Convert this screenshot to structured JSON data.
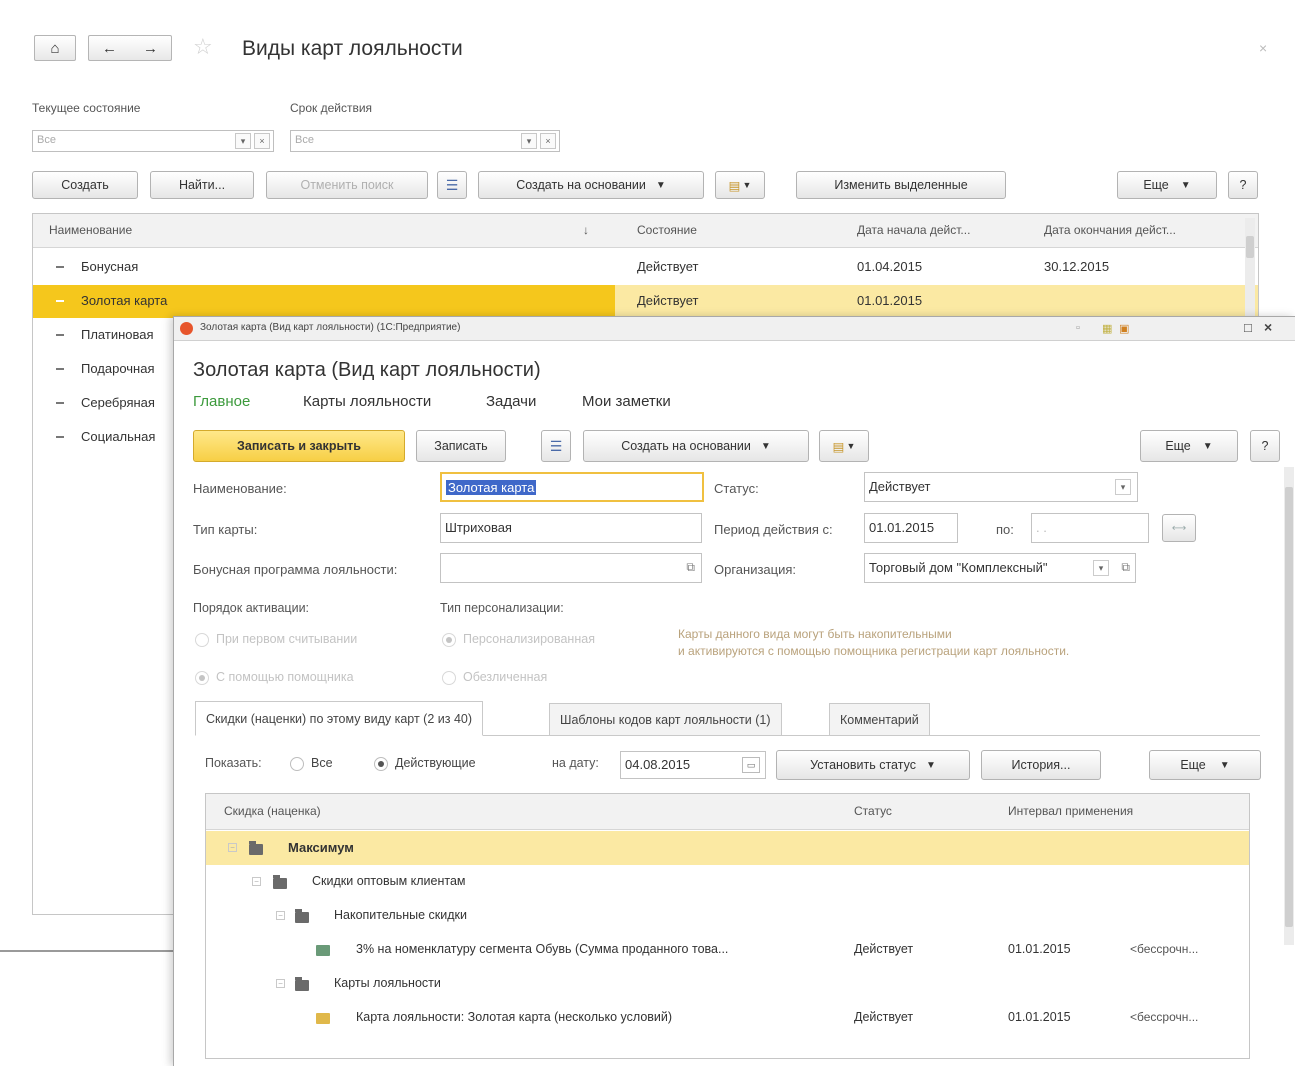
{
  "list_window": {
    "title": "Виды карт лояльности",
    "close": "×",
    "filters": {
      "state_label": "Текущее состояние",
      "state_value": "Все",
      "period_label": "Срок действия",
      "period_value": "Все"
    },
    "toolbar": {
      "create": "Создать",
      "find": "Найти...",
      "cancel_search": "Отменить поиск",
      "create_based_on": "Создать на основании",
      "change_selected": "Изменить выделенные",
      "more": "Еще",
      "help": "?"
    },
    "columns": [
      "Наименование",
      "Состояние",
      "Дата начала дейст...",
      "Дата окончания дейст..."
    ],
    "sort_indicator": "↓",
    "rows": [
      {
        "name": "Бонусная",
        "state": "Действует",
        "start": "01.04.2015",
        "end": "30.12.2015"
      },
      {
        "name": "Золотая карта",
        "state": "Действует",
        "start": "01.01.2015",
        "end": ""
      },
      {
        "name": "Платиновая",
        "state": "",
        "start": "",
        "end": ""
      },
      {
        "name": "Подарочная",
        "state": "",
        "start": "",
        "end": ""
      },
      {
        "name": "Серебряная",
        "state": "",
        "start": "",
        "end": ""
      },
      {
        "name": "Социальная",
        "state": "",
        "start": "",
        "end": ""
      }
    ]
  },
  "form_window": {
    "titlebar": "Золотая карта (Вид карт лояльности) (1С:Предприятие)",
    "title": "Золотая карта (Вид карт лояльности)",
    "nav": [
      "Главное",
      "Карты лояльности",
      "Задачи",
      "Мои заметки"
    ],
    "toolbar": {
      "save_close": "Записать и закрыть",
      "save": "Записать",
      "create_based_on": "Создать на основании",
      "more": "Еще",
      "help": "?"
    },
    "fields": {
      "name_label": "Наименование:",
      "name_value": "Золотая карта",
      "status_label": "Статус:",
      "status_value": "Действует",
      "card_type_label": "Тип карты:",
      "card_type_value": "Штриховая",
      "period_label": "Период действия с:",
      "period_from": "01.01.2015",
      "period_to_label": "по:",
      "period_to_placeholder": ". .",
      "bonus_label": "Бонусная программа лояльности:",
      "org_label": "Организация:",
      "org_value": "Торговый дом \"Комплексный\"",
      "activation_label": "Порядок активации:",
      "activation_options": [
        "При первом считывании",
        "С помощью помощника"
      ],
      "personalization_label": "Тип персонализации:",
      "personalization_options": [
        "Персонализированная",
        "Обезличенная"
      ],
      "hint_line1": "Карты данного вида могут быть накопительными",
      "hint_line2": "и активируются с помощью помощника регистрации карт лояльности."
    },
    "tabs": [
      "Скидки (наценки) по этому виду карт (2 из 40)",
      "Шаблоны кодов карт лояльности (1)",
      "Комментарий"
    ],
    "discounts_toolbar": {
      "show_label": "Показать:",
      "all": "Все",
      "active": "Действующие",
      "date_label": "на дату:",
      "date_value": "04.08.2015",
      "set_status": "Установить статус",
      "history": "История...",
      "more": "Еще"
    },
    "discount_columns": [
      "Скидка (наценка)",
      "Статус",
      "Интервал применения"
    ],
    "discount_rows": [
      {
        "name": "Максимум",
        "status": "",
        "from": "",
        "to": "",
        "level": 0
      },
      {
        "name": "Скидки оптовым клиентам",
        "status": "",
        "from": "",
        "to": "",
        "level": 1
      },
      {
        "name": "Накопительные скидки",
        "status": "",
        "from": "",
        "to": "",
        "level": 2
      },
      {
        "name": "3% на номенклатуру сегмента Обувь (Сумма проданного това...",
        "status": "Действует",
        "from": "01.01.2015",
        "to": "<бессрочн...",
        "level": 3
      },
      {
        "name": "Карты лояльности",
        "status": "",
        "from": "",
        "to": "",
        "level": 2
      },
      {
        "name": "Карта лояльности: Золотая карта (несколько условий)",
        "status": "Действует",
        "from": "01.01.2015",
        "to": "<бессрочн...",
        "level": 3
      }
    ]
  }
}
